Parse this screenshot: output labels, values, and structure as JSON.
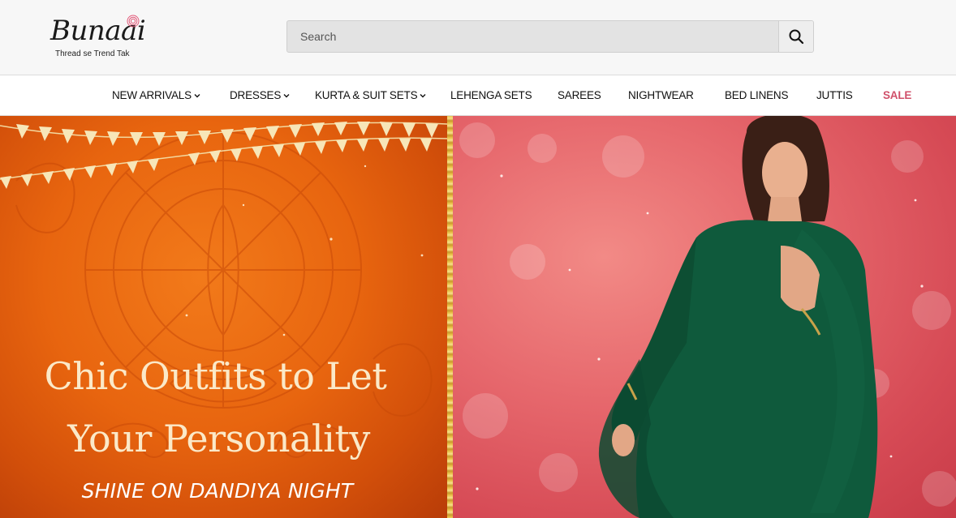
{
  "brand": {
    "name": "Bunaai",
    "tagline": "Thread se Trend Tak"
  },
  "search": {
    "placeholder": "Search",
    "icon": "search-icon"
  },
  "nav": {
    "items": [
      {
        "label": "NEW ARRIVALS",
        "has_dropdown": true
      },
      {
        "label": "DRESSES",
        "has_dropdown": true
      },
      {
        "label": "KURTA & SUIT SETS",
        "has_dropdown": true
      },
      {
        "label": "LEHENGA SETS",
        "has_dropdown": false
      },
      {
        "label": "SAREES",
        "has_dropdown": false
      },
      {
        "label": "NIGHTWEAR",
        "has_dropdown": false
      },
      {
        "label": "BED LINENS",
        "has_dropdown": false
      },
      {
        "label": "JUTTIS",
        "has_dropdown": false
      },
      {
        "label": "SALE",
        "has_dropdown": false
      }
    ],
    "sale_color": "#d0506a"
  },
  "hero": {
    "headline_line1": "Chic Outfits to Let",
    "headline_line2": "Your Personality",
    "subline": "SHINE ON DANDIYA NIGHT",
    "left_color": "#e8650f",
    "right_color": "#e6676c",
    "outfit_color": "#0f5a3c"
  }
}
